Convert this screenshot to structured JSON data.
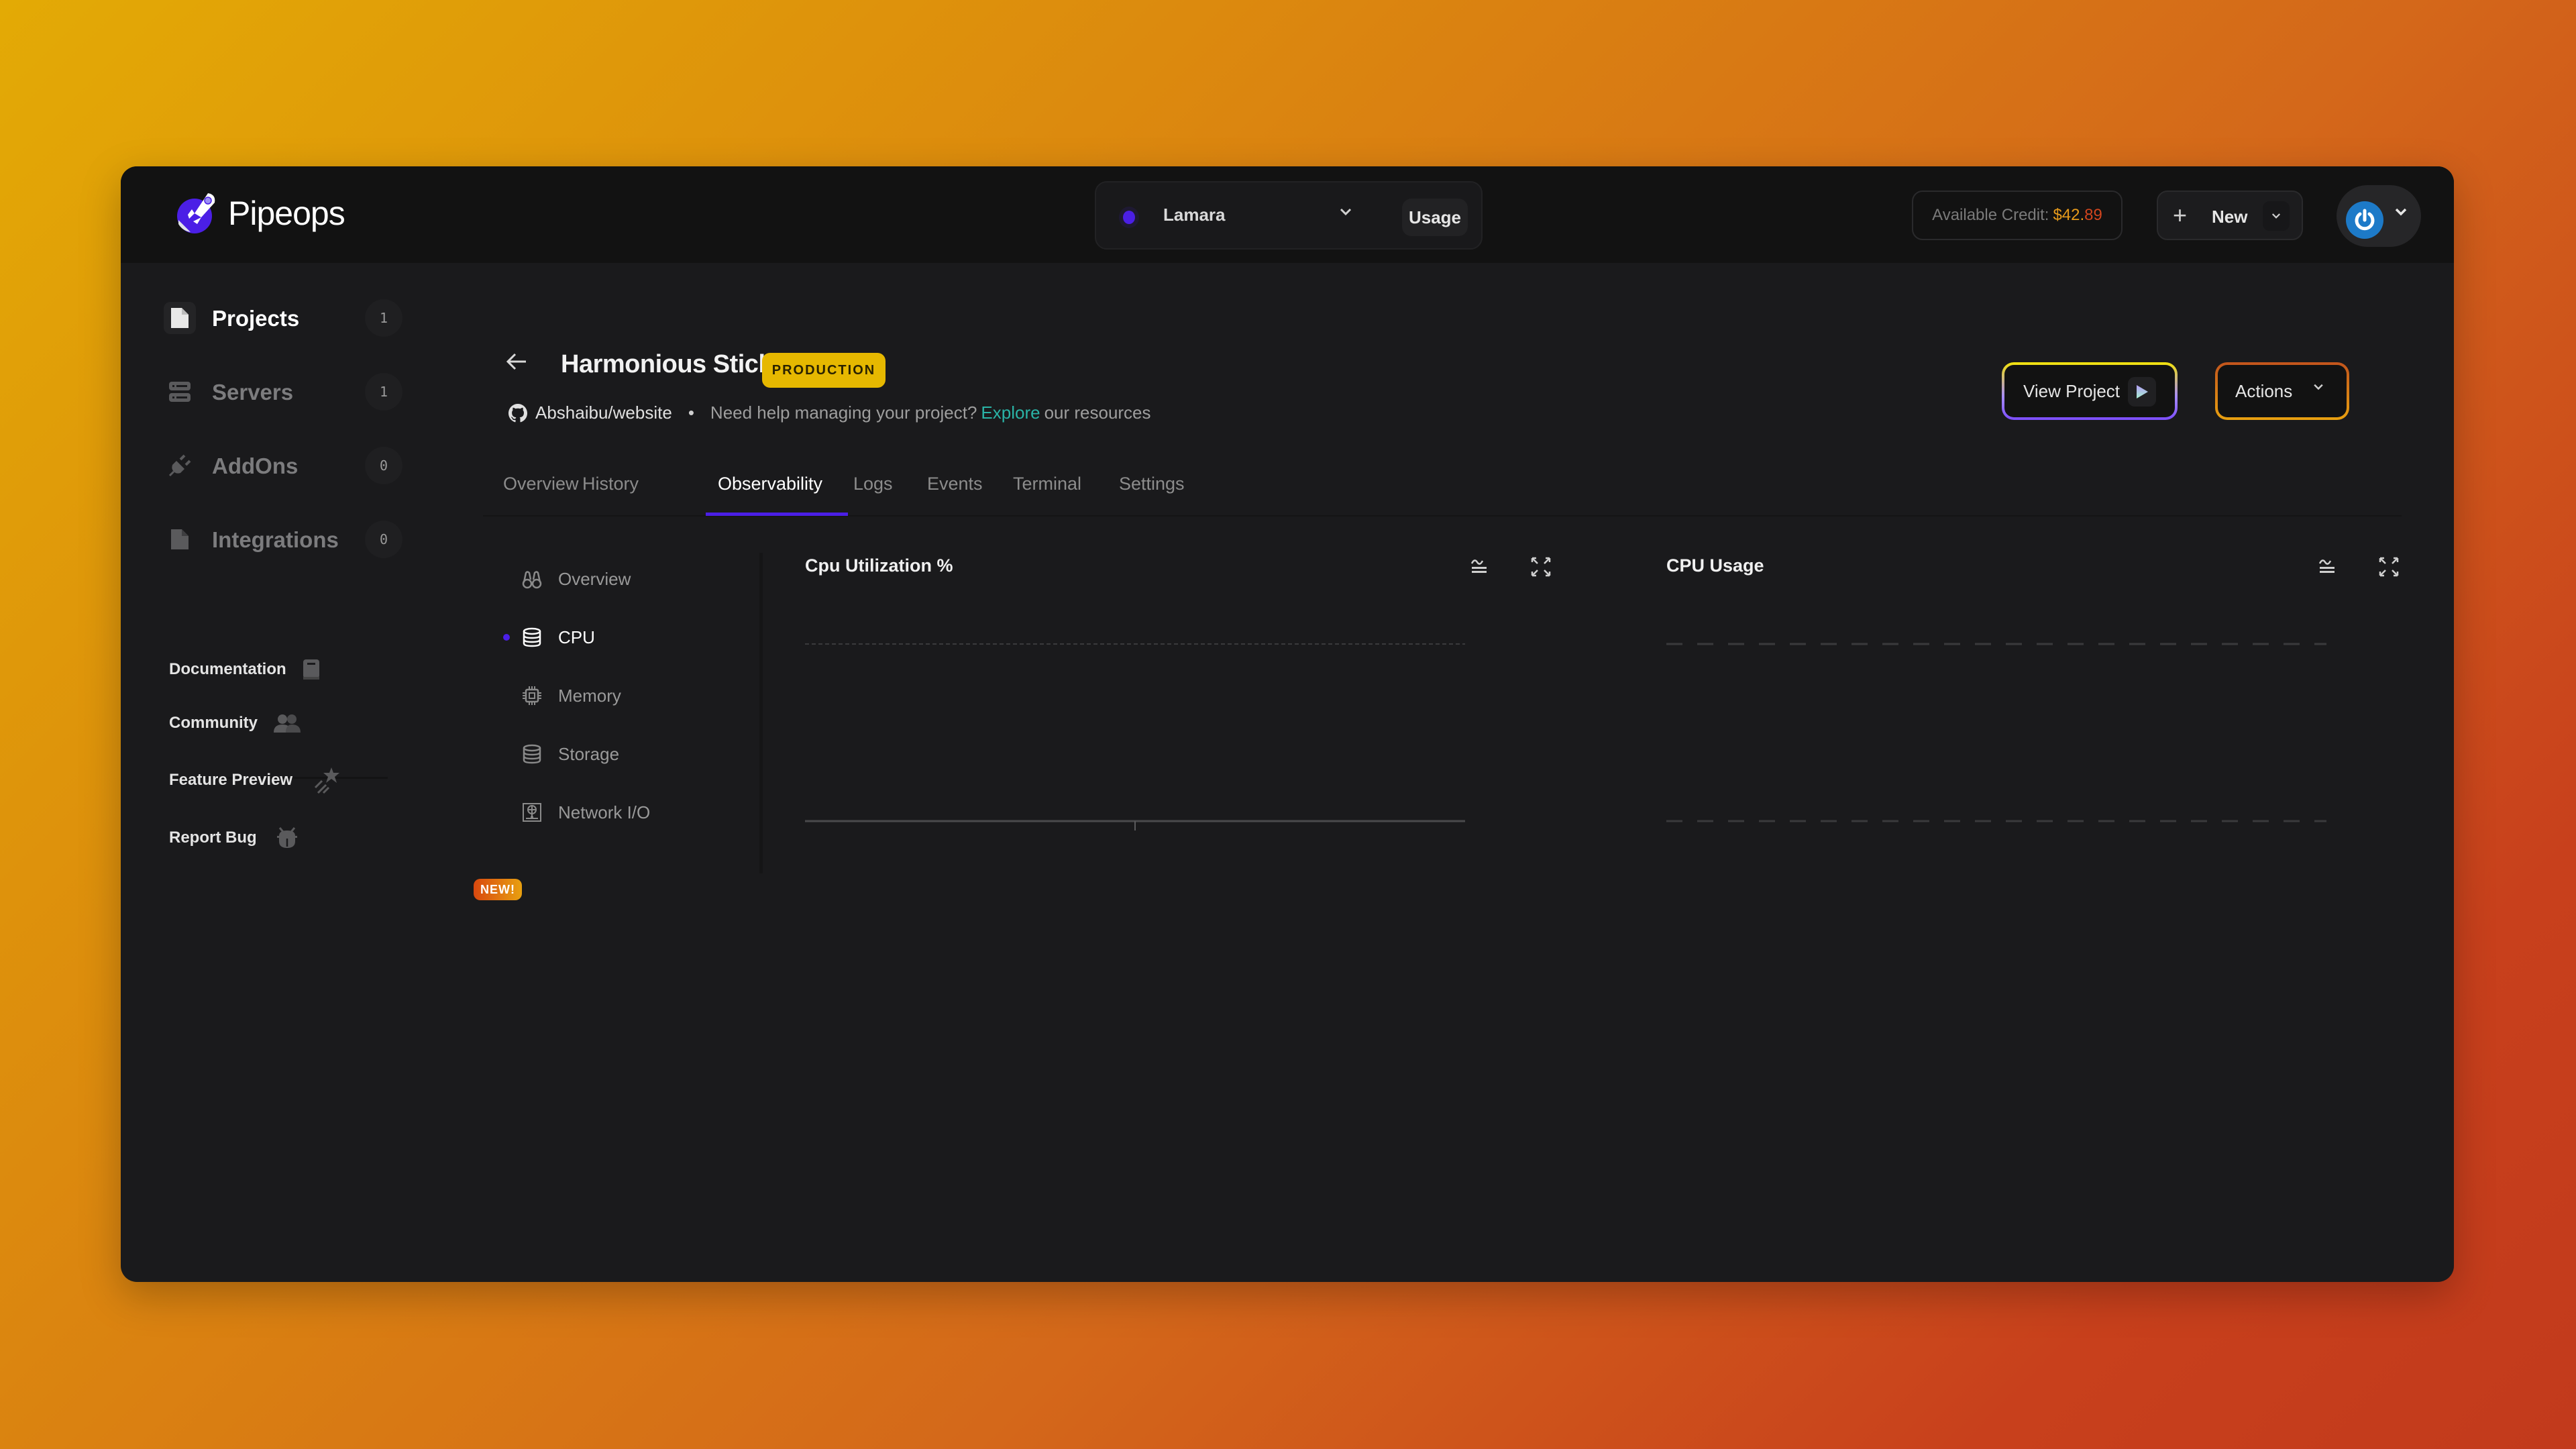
{
  "app": {
    "name": "Pipeops",
    "brand_color": "#4b1fe6"
  },
  "header": {
    "project_switcher": {
      "selected": "Lamara",
      "status_color": "#4b1fe6"
    },
    "usage_label": "Usage",
    "credit": {
      "label": "Available Credit:",
      "amount_main": "$42.",
      "amount_cents": "89"
    },
    "new_label": "New"
  },
  "sidebar": {
    "items": [
      {
        "label": "Projects",
        "count": "1",
        "icon": "file-icon",
        "active": true
      },
      {
        "label": "Servers",
        "count": "1",
        "icon": "server-icon",
        "active": false
      },
      {
        "label": "AddOns",
        "count": "0",
        "icon": "plug-icon",
        "active": false
      },
      {
        "label": "Integrations",
        "count": "0",
        "icon": "file-icon",
        "active": false
      }
    ],
    "aux": [
      {
        "label": "Documentation",
        "icon": "book-icon"
      },
      {
        "label": "Community",
        "icon": "users-icon",
        "badge": "NEW!"
      },
      {
        "label": "Feature Preview",
        "icon": "shooting-star-icon"
      },
      {
        "label": "Report Bug",
        "icon": "bug-icon"
      }
    ]
  },
  "project": {
    "title": "Harmonious Stick",
    "environment": "PRODUCTION",
    "repo": "Abshaibu/website",
    "help_prefix": "Need help managing your project?",
    "help_link": "Explore",
    "help_suffix": "our resources",
    "view_project_label": "View Project",
    "actions_label": "Actions"
  },
  "tabs": [
    {
      "label": "Overview"
    },
    {
      "label": "History"
    },
    {
      "label": "Observability",
      "active": true
    },
    {
      "label": "Logs"
    },
    {
      "label": "Events"
    },
    {
      "label": "Terminal"
    },
    {
      "label": "Settings"
    }
  ],
  "observability_nav": [
    {
      "label": "Overview",
      "icon": "binoculars-icon"
    },
    {
      "label": "CPU",
      "icon": "database-icon",
      "active": true
    },
    {
      "label": "Memory",
      "icon": "chip-icon"
    },
    {
      "label": "Storage",
      "icon": "database-icon"
    },
    {
      "label": "Network I/O",
      "icon": "network-icon"
    }
  ],
  "charts": [
    {
      "title": "Cpu Utilization %",
      "state": "empty"
    },
    {
      "title": "CPU Usage",
      "state": "empty"
    }
  ]
}
